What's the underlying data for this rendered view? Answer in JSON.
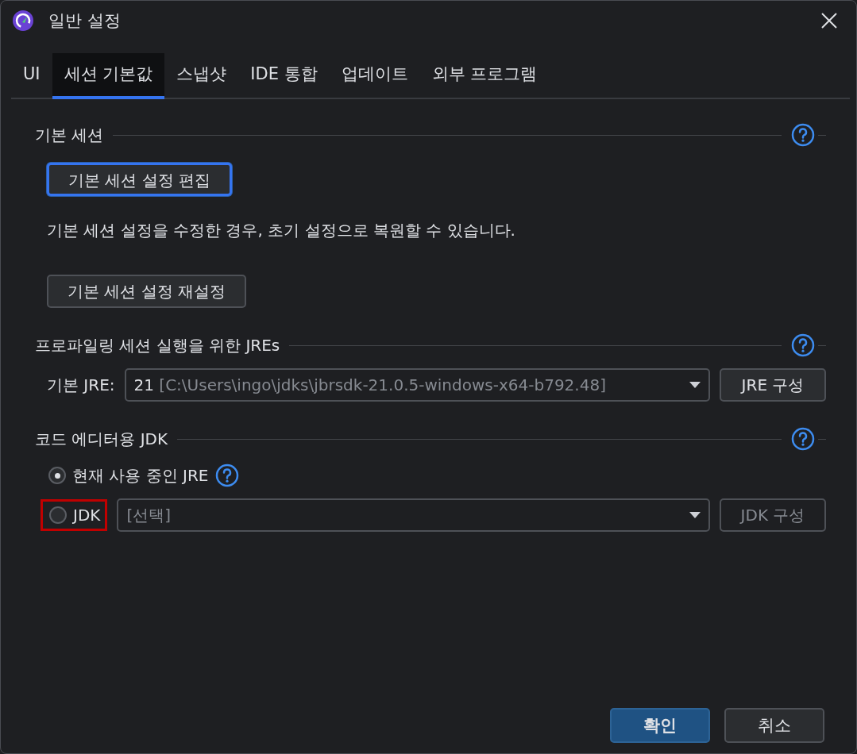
{
  "window": {
    "title": "일반 설정"
  },
  "tabs": [
    {
      "label": "UI",
      "selected": false
    },
    {
      "label": "세션 기본값",
      "selected": true
    },
    {
      "label": "스냅샷",
      "selected": false
    },
    {
      "label": "IDE 통합",
      "selected": false
    },
    {
      "label": "업데이트",
      "selected": false
    },
    {
      "label": "외부 프로그램",
      "selected": false
    }
  ],
  "sections": [
    {
      "title": "기본 세션",
      "help": true,
      "items": [
        {
          "kind": "button",
          "label": "기본 세션 설정 편집",
          "focused": true
        },
        {
          "kind": "text",
          "text": "기본 세션 설정을 수정한 경우, 초기 설정으로 복원할 수 있습니다."
        },
        {
          "kind": "button",
          "label": "기본 세션 설정 재설정",
          "focused": false
        }
      ]
    },
    {
      "title": "프로파일링 세션 실행을 위한 JREs",
      "help": true,
      "items": [
        {
          "kind": "combo-row",
          "label": "기본 JRE:",
          "value": "21",
          "detail": "[C:\\Users\\ingo\\jdks\\jbrsdk-21.0.5-windows-x64-b792.48]",
          "disabled": false,
          "button": "JRE 구성"
        }
      ]
    },
    {
      "title": "코드 에디터용 JDK",
      "help": true,
      "items": [
        {
          "kind": "radio",
          "label": "현재 사용 중인 JRE",
          "selected": true,
          "help": true
        },
        {
          "kind": "radio-combo",
          "label": "JDK",
          "selected": false,
          "highlighted": true,
          "value": "[선택]",
          "disabled": true,
          "button": "JDK 구성"
        }
      ]
    }
  ],
  "buttons": [
    {
      "label": "확인",
      "primary": true
    },
    {
      "label": "취소",
      "primary": false
    }
  ]
}
